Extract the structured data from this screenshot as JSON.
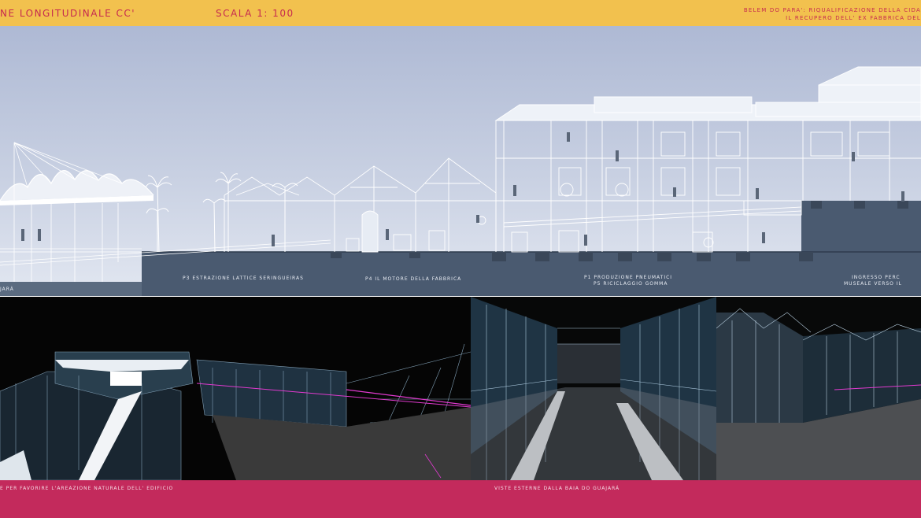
{
  "header": {
    "title": "NE LONGITUDINALE CC'",
    "scale": "SCALA 1: 100",
    "project_line1": "BELEM DO PARA': RIQUALIFICAZIONE DELLA CIDA",
    "project_line2": "IL RECUPERO DELL' EX FABBRICA DEL"
  },
  "section": {
    "label_left": "JARÁ",
    "label_p3": "P3  ESTRAZIONE LATTICE SERINGUEIRAS",
    "label_p4": "P4   IL MOTORE DELLA FABBRICA",
    "label_p1": "P1  PRODUZIONE PNEUMATICI",
    "label_p5": "P5  RICICLAGGIO GOMMA",
    "label_entrance1": "INGRESSO   PERC",
    "label_entrance2": "MUSEALE VERSO IL"
  },
  "footer": {
    "caption_left": "E PER FAVORIRE L'AREAZIONE NATURALE DELL' EDIFICIO",
    "caption_right": "VISTE ESTERNE DALLA BAIA DO GUAJARÁ"
  },
  "colors": {
    "top_bar": "#f2c14e",
    "title_text": "#c62a4f",
    "bottom_bar": "#c32a5c",
    "ground_section": "#4a5a70",
    "sky": "#b6c2da"
  }
}
